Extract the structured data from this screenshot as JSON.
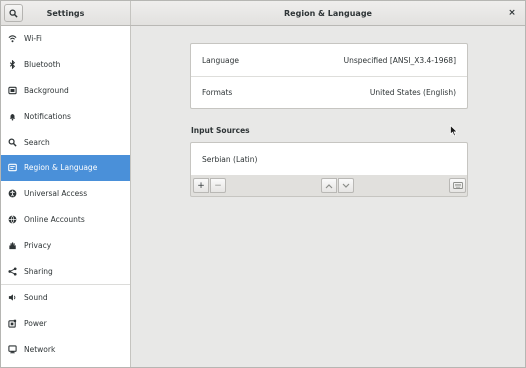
{
  "header": {
    "left_title": "Settings",
    "right_title": "Region & Language",
    "close_label": "×"
  },
  "sidebar": {
    "items": [
      {
        "label": "Wi-Fi",
        "icon": "wifi-icon"
      },
      {
        "label": "Bluetooth",
        "icon": "bluetooth-icon"
      },
      {
        "label": "Background",
        "icon": "background-icon"
      },
      {
        "label": "Notifications",
        "icon": "bell-icon"
      },
      {
        "label": "Search",
        "icon": "search-icon"
      },
      {
        "label": "Region & Language",
        "icon": "region-icon",
        "active": true
      },
      {
        "label": "Universal Access",
        "icon": "accessibility-icon"
      },
      {
        "label": "Online Accounts",
        "icon": "online-accounts-icon"
      },
      {
        "label": "Privacy",
        "icon": "privacy-icon"
      },
      {
        "label": "Sharing",
        "icon": "share-icon"
      },
      {
        "label": "Sound",
        "icon": "speaker-icon"
      },
      {
        "label": "Power",
        "icon": "power-icon"
      },
      {
        "label": "Network",
        "icon": "network-icon"
      }
    ]
  },
  "main": {
    "language": {
      "label": "Language",
      "value": "Unspecified [ANSI_X3.4-1968]"
    },
    "formats": {
      "label": "Formats",
      "value": "United States (English)"
    },
    "input_sources_title": "Input Sources",
    "input_sources": [
      {
        "label": "Serbian (Latin)"
      }
    ],
    "toolbar": {
      "add_label": "+",
      "remove_label": "−"
    }
  },
  "colors": {
    "accent": "#4a90d9",
    "background": "#e8e8e7",
    "sidebar_bg": "#ffffff"
  }
}
